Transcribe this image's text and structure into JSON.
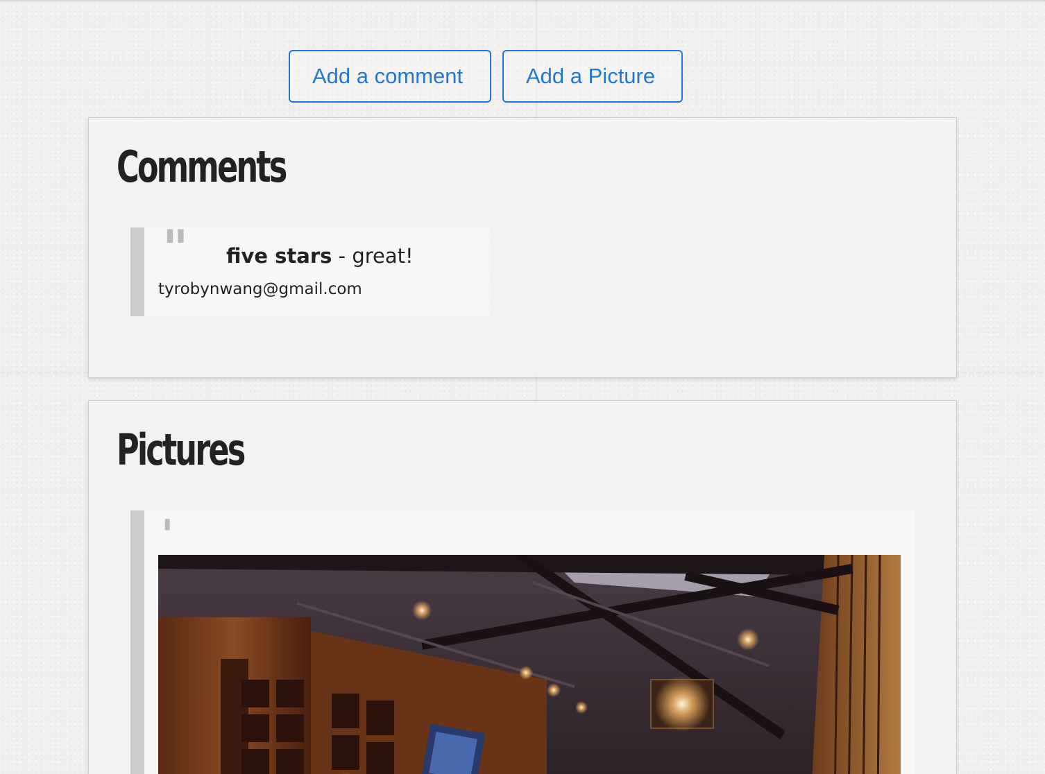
{
  "actions": {
    "add_comment_label": "Add a comment",
    "add_picture_label": "Add a Picture"
  },
  "comments": {
    "title": "Comments",
    "items": [
      {
        "rating": "five stars",
        "separator": "-",
        "text": "great!",
        "author": "tyrobynwang@gmail.com"
      }
    ]
  },
  "pictures": {
    "title": "Pictures"
  },
  "colors": {
    "accent": "#1f79d2",
    "heading": "#222222",
    "quote_bar": "#cdcbc9"
  }
}
